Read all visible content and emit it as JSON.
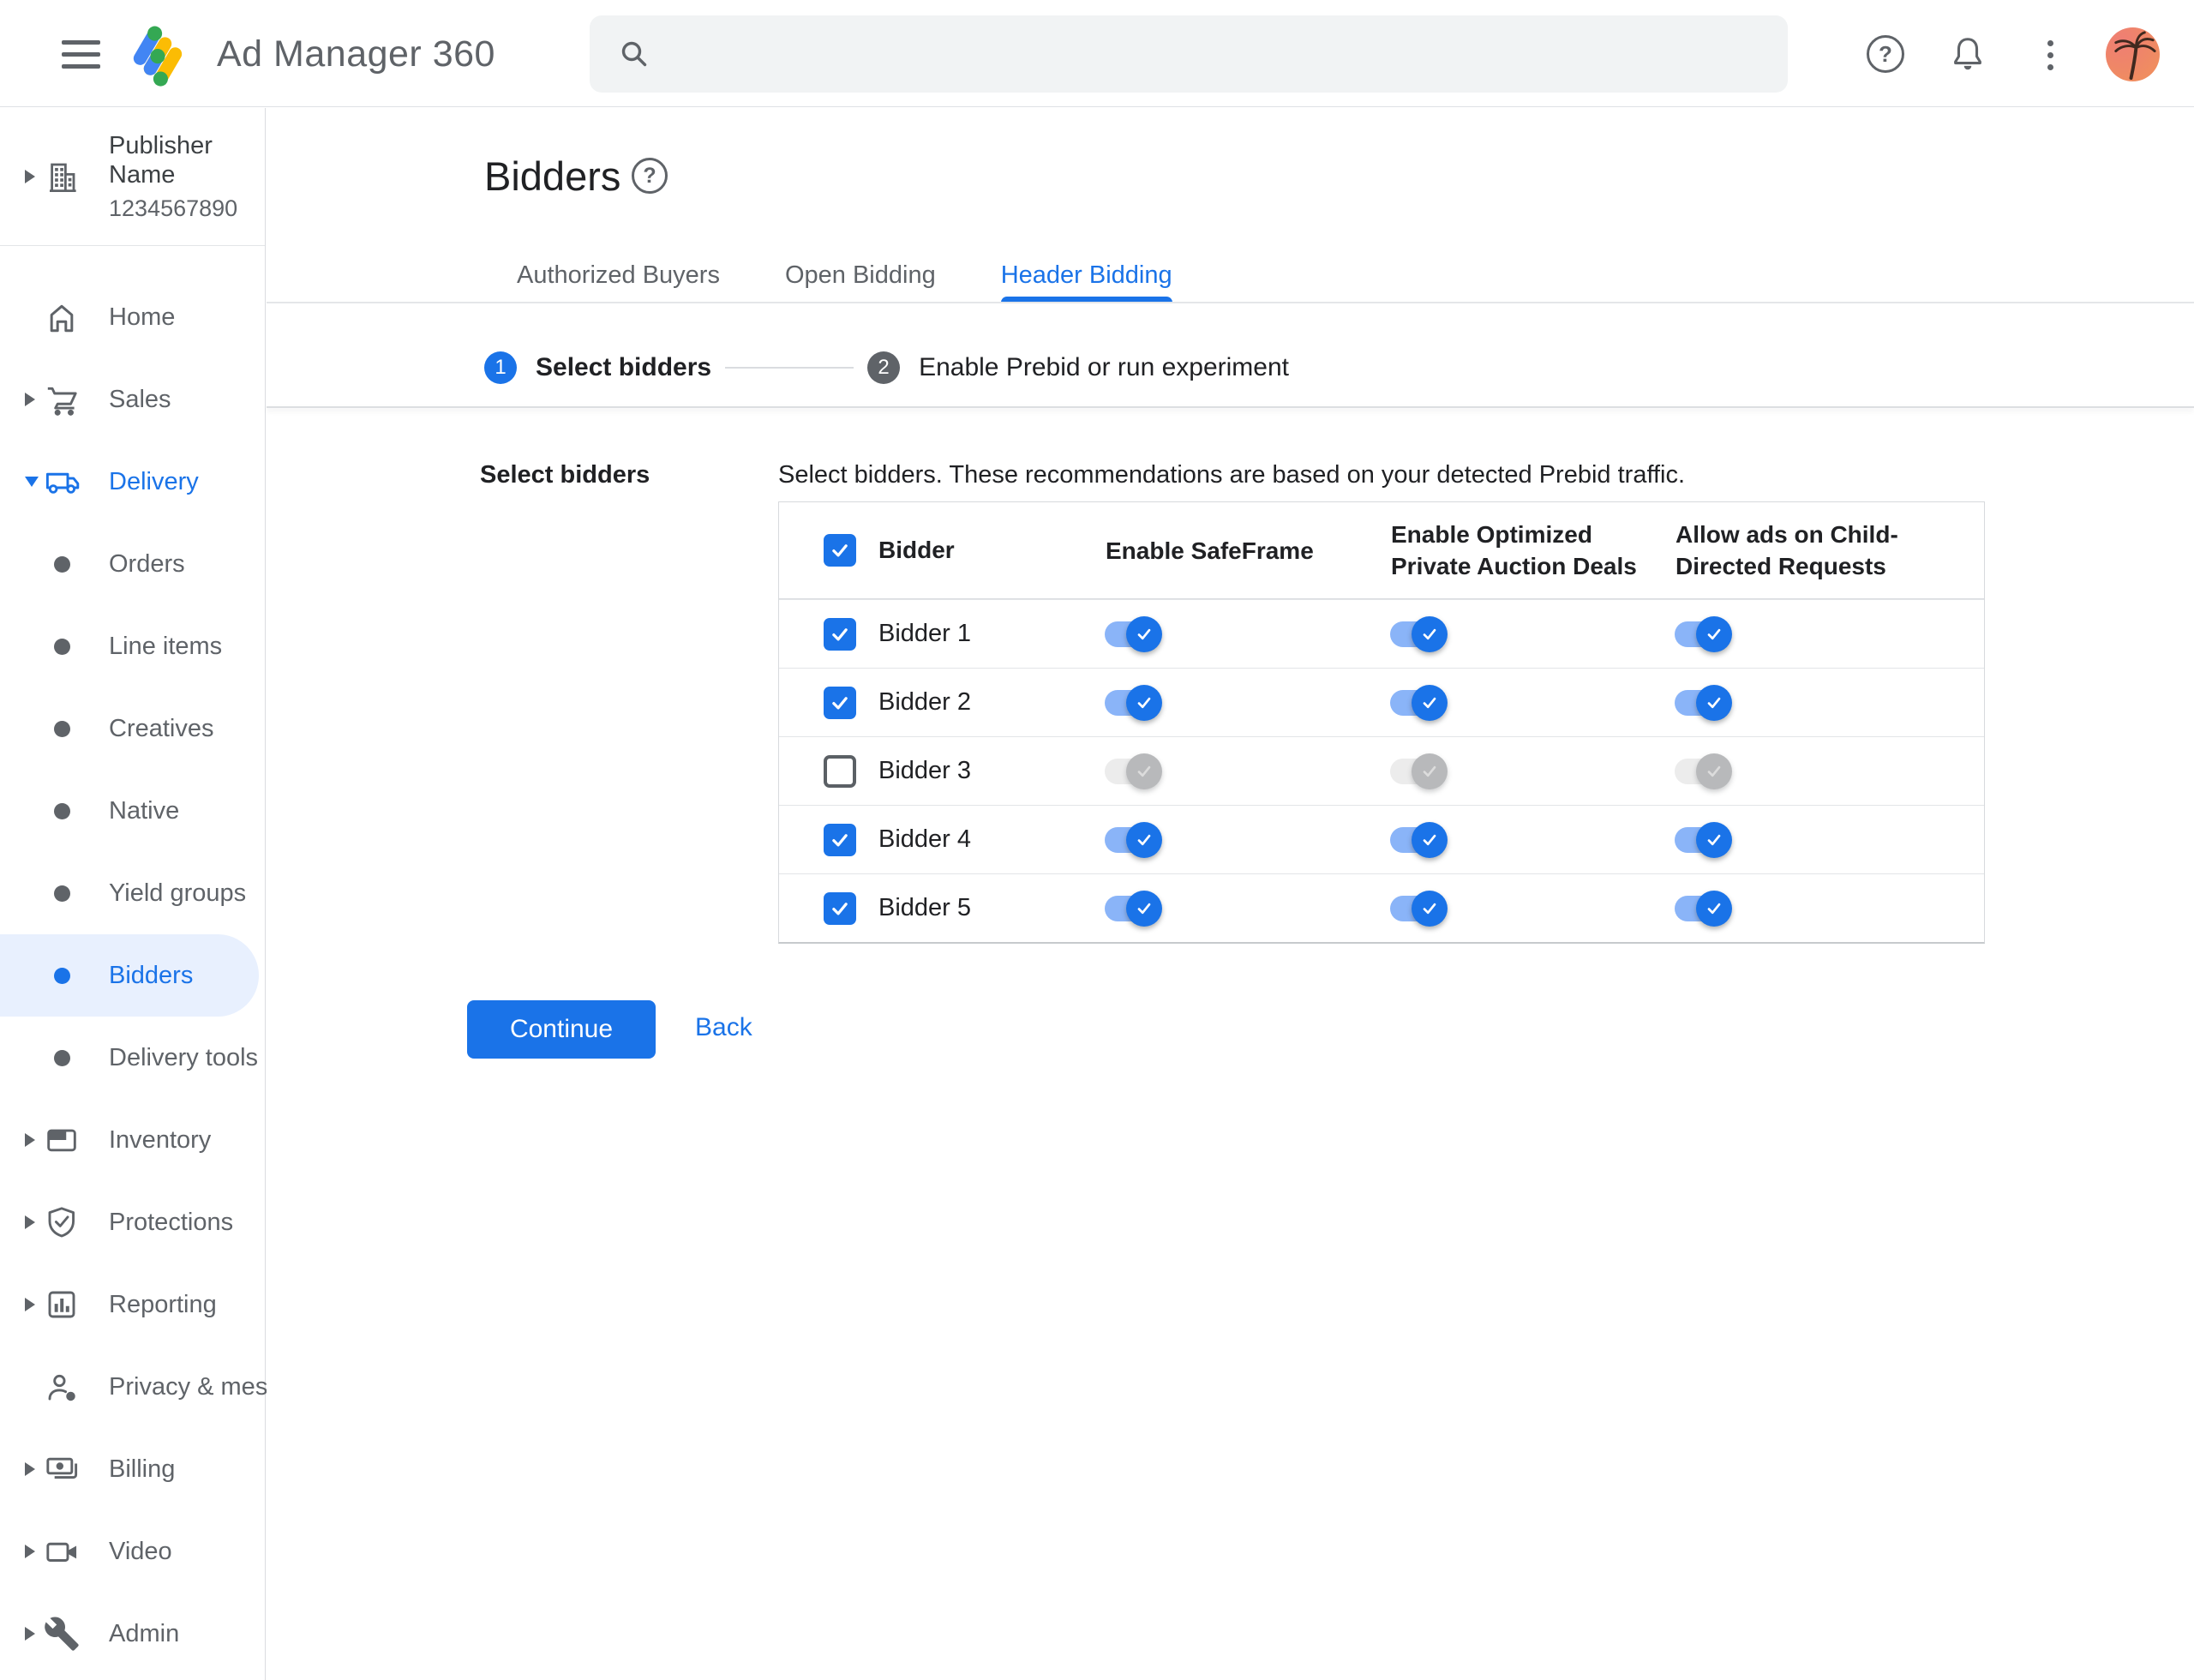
{
  "header": {
    "app_name": "Ad Manager 360",
    "search_placeholder": ""
  },
  "account": {
    "name": "Publisher Name",
    "id": "1234567890"
  },
  "icons": {
    "help_glyph": "?"
  },
  "colors": {
    "accent_blue": "#1a73e8",
    "toggle_track_on": "#8ab4f8",
    "toggle_track_off": "#ececec",
    "toggle_thumb_off": "#b8b9bb",
    "selected_item_bg": "#e8f0fe",
    "text_dark": "#202124",
    "text_gray": "#5f6368",
    "border": "#dadce0",
    "search_bg": "#f1f3f4"
  },
  "sidebar": {
    "items": [
      {
        "label": "Home"
      },
      {
        "label": "Sales"
      },
      {
        "label": "Delivery"
      },
      {
        "label": "Orders"
      },
      {
        "label": "Line items"
      },
      {
        "label": "Creatives"
      },
      {
        "label": "Native"
      },
      {
        "label": "Yield groups"
      },
      {
        "label": "Bidders"
      },
      {
        "label": "Delivery tools"
      },
      {
        "label": "Inventory"
      },
      {
        "label": "Protections"
      },
      {
        "label": "Reporting"
      },
      {
        "label": "Privacy & messaging"
      },
      {
        "label": "Billing"
      },
      {
        "label": "Video"
      },
      {
        "label": "Admin"
      }
    ]
  },
  "page": {
    "title": "Bidders"
  },
  "tabs": [
    {
      "label": "Authorized Buyers"
    },
    {
      "label": "Open Bidding"
    },
    {
      "label": "Header Bidding"
    }
  ],
  "stepper": {
    "step1_number": "1",
    "step1_label": "Select bidders",
    "step2_number": "2",
    "step2_label": "Enable Prebid or run experiment"
  },
  "form": {
    "section_label": "Select bidders",
    "description": "Select bidders. These recommendations are based on your detected Prebid traffic."
  },
  "table": {
    "headers": {
      "bidder": "Bidder",
      "safeframe": "Enable SafeFrame",
      "optimized": "Enable Optimized\nPrivate Auction Deals",
      "child_directed": "Allow ads on Child-\nDirected Requests"
    },
    "rows": [
      {
        "name": "Bidder 1",
        "checked": true,
        "safeframe": true,
        "optimized": true,
        "child_directed": true
      },
      {
        "name": "Bidder 2",
        "checked": true,
        "safeframe": true,
        "optimized": true,
        "child_directed": true
      },
      {
        "name": "Bidder 3",
        "checked": false,
        "safeframe": false,
        "optimized": false,
        "child_directed": false
      },
      {
        "name": "Bidder 4",
        "checked": true,
        "safeframe": true,
        "optimized": true,
        "child_directed": true
      },
      {
        "name": "Bidder 5",
        "checked": true,
        "safeframe": true,
        "optimized": true,
        "child_directed": true
      }
    ]
  },
  "actions": {
    "continue_label": "Continue",
    "back_label": "Back"
  }
}
